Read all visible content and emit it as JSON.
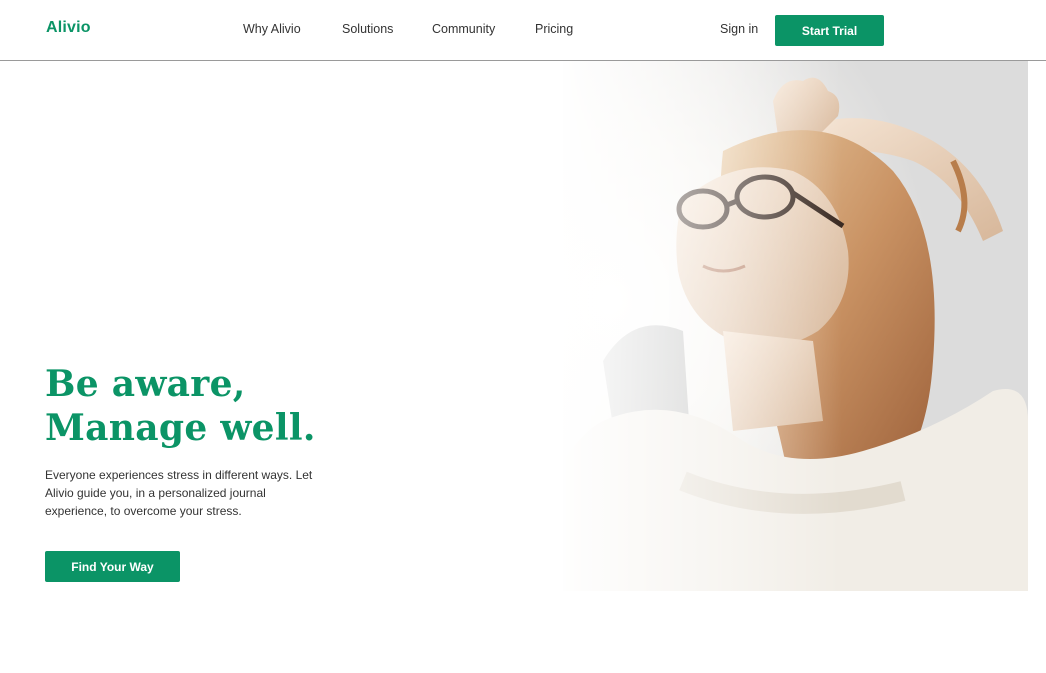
{
  "header": {
    "logo": "Alivio",
    "nav": [
      "Why Alivio",
      "Solutions",
      "Community",
      "Pricing"
    ],
    "sign_in": "Sign in",
    "start_trial": "Start Trial"
  },
  "hero": {
    "headline_line1": "Be aware,",
    "headline_line2": "Manage well.",
    "description": "Everyone experiences stress in different ways. Let Alivio guide you, in a personalized journal experience, to overcome your stress.",
    "cta": "Find Your Way",
    "image": "woman-relaxing-photo"
  },
  "colors": {
    "brand_green": "#0b9466",
    "text": "#333333",
    "background": "#ffffff"
  }
}
